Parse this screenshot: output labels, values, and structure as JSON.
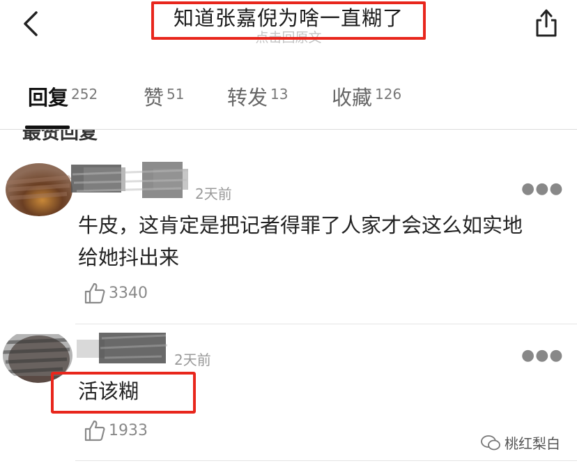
{
  "header": {
    "title": "知道张嘉倪为啥一直糊了",
    "subtitle": "点击回原文"
  },
  "tabs": [
    {
      "label": "回复",
      "count": "252",
      "active": true
    },
    {
      "label": "赞",
      "count": "51"
    },
    {
      "label": "转发",
      "count": "13"
    },
    {
      "label": "收藏",
      "count": "126"
    }
  ],
  "section": {
    "heading": "最赞回复"
  },
  "comments": [
    {
      "time": "2天前",
      "text_line1": "牛皮，这肯定是把记者得罪了人家才会这么如实地",
      "text_line2": "给她抖出来",
      "likes": "3340"
    },
    {
      "time": "2天前",
      "text": "活该糊",
      "likes": "1933"
    }
  ],
  "watermark": {
    "text": "桃红梨白"
  },
  "colors": {
    "highlight": "#e8261c",
    "muted": "#999999"
  }
}
